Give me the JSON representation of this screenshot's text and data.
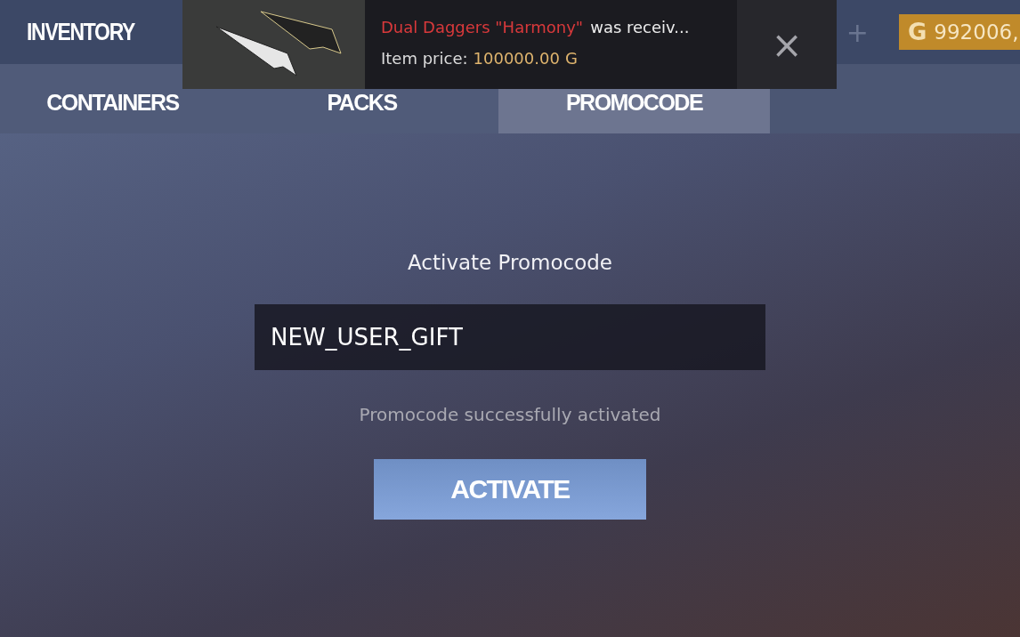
{
  "header": {
    "title": "INVENTORY",
    "add_button": "+",
    "balance": {
      "currency": "G",
      "amount": "992006,"
    }
  },
  "tabs": [
    {
      "label": "CONTAINERS",
      "selected": false
    },
    {
      "label": "PACKS",
      "selected": false
    },
    {
      "label": "PROMOCODE",
      "selected": true
    }
  ],
  "notification": {
    "item_name": "Dual Daggers \"Harmony\"",
    "message": "was receiv...",
    "price_label": "Item price:",
    "price": "100000.00",
    "currency": "G",
    "close": "×"
  },
  "promocode": {
    "title": "Activate Promocode",
    "value": "NEW_USER_GIFT",
    "status": "Promocode successfully activated",
    "button": "ACTIVATE"
  }
}
